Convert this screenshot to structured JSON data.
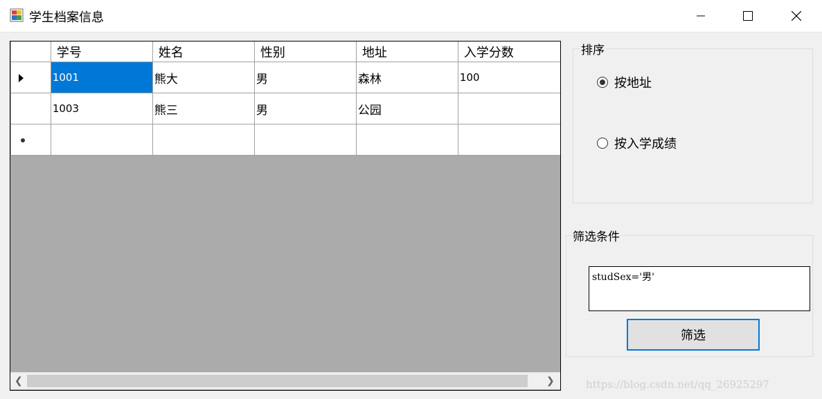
{
  "window": {
    "title": "学生档案信息"
  },
  "grid": {
    "columns": [
      "学号",
      "姓名",
      "性别",
      "地址",
      "入学分数"
    ],
    "rows": [
      {
        "indicator": "current",
        "cells": [
          "1001",
          "熊大",
          "男",
          "森林",
          "100"
        ]
      },
      {
        "indicator": "",
        "cells": [
          "1003",
          "熊三",
          "男",
          "公园",
          ""
        ]
      },
      {
        "indicator": "new",
        "cells": [
          "",
          "",
          "",
          "",
          ""
        ]
      }
    ],
    "selected_cell": {
      "row": 0,
      "col": 0
    },
    "selection_color": "#0078d7"
  },
  "sort_group": {
    "label": "排序",
    "options": [
      {
        "label": "按地址",
        "checked": true
      },
      {
        "label": "按入学成绩",
        "checked": false
      }
    ]
  },
  "filter_group": {
    "label": "筛选条件",
    "input_value": "studSex='男'",
    "button_label": "筛选"
  },
  "watermark": "https://blog.csdn.net/qq_26925297"
}
